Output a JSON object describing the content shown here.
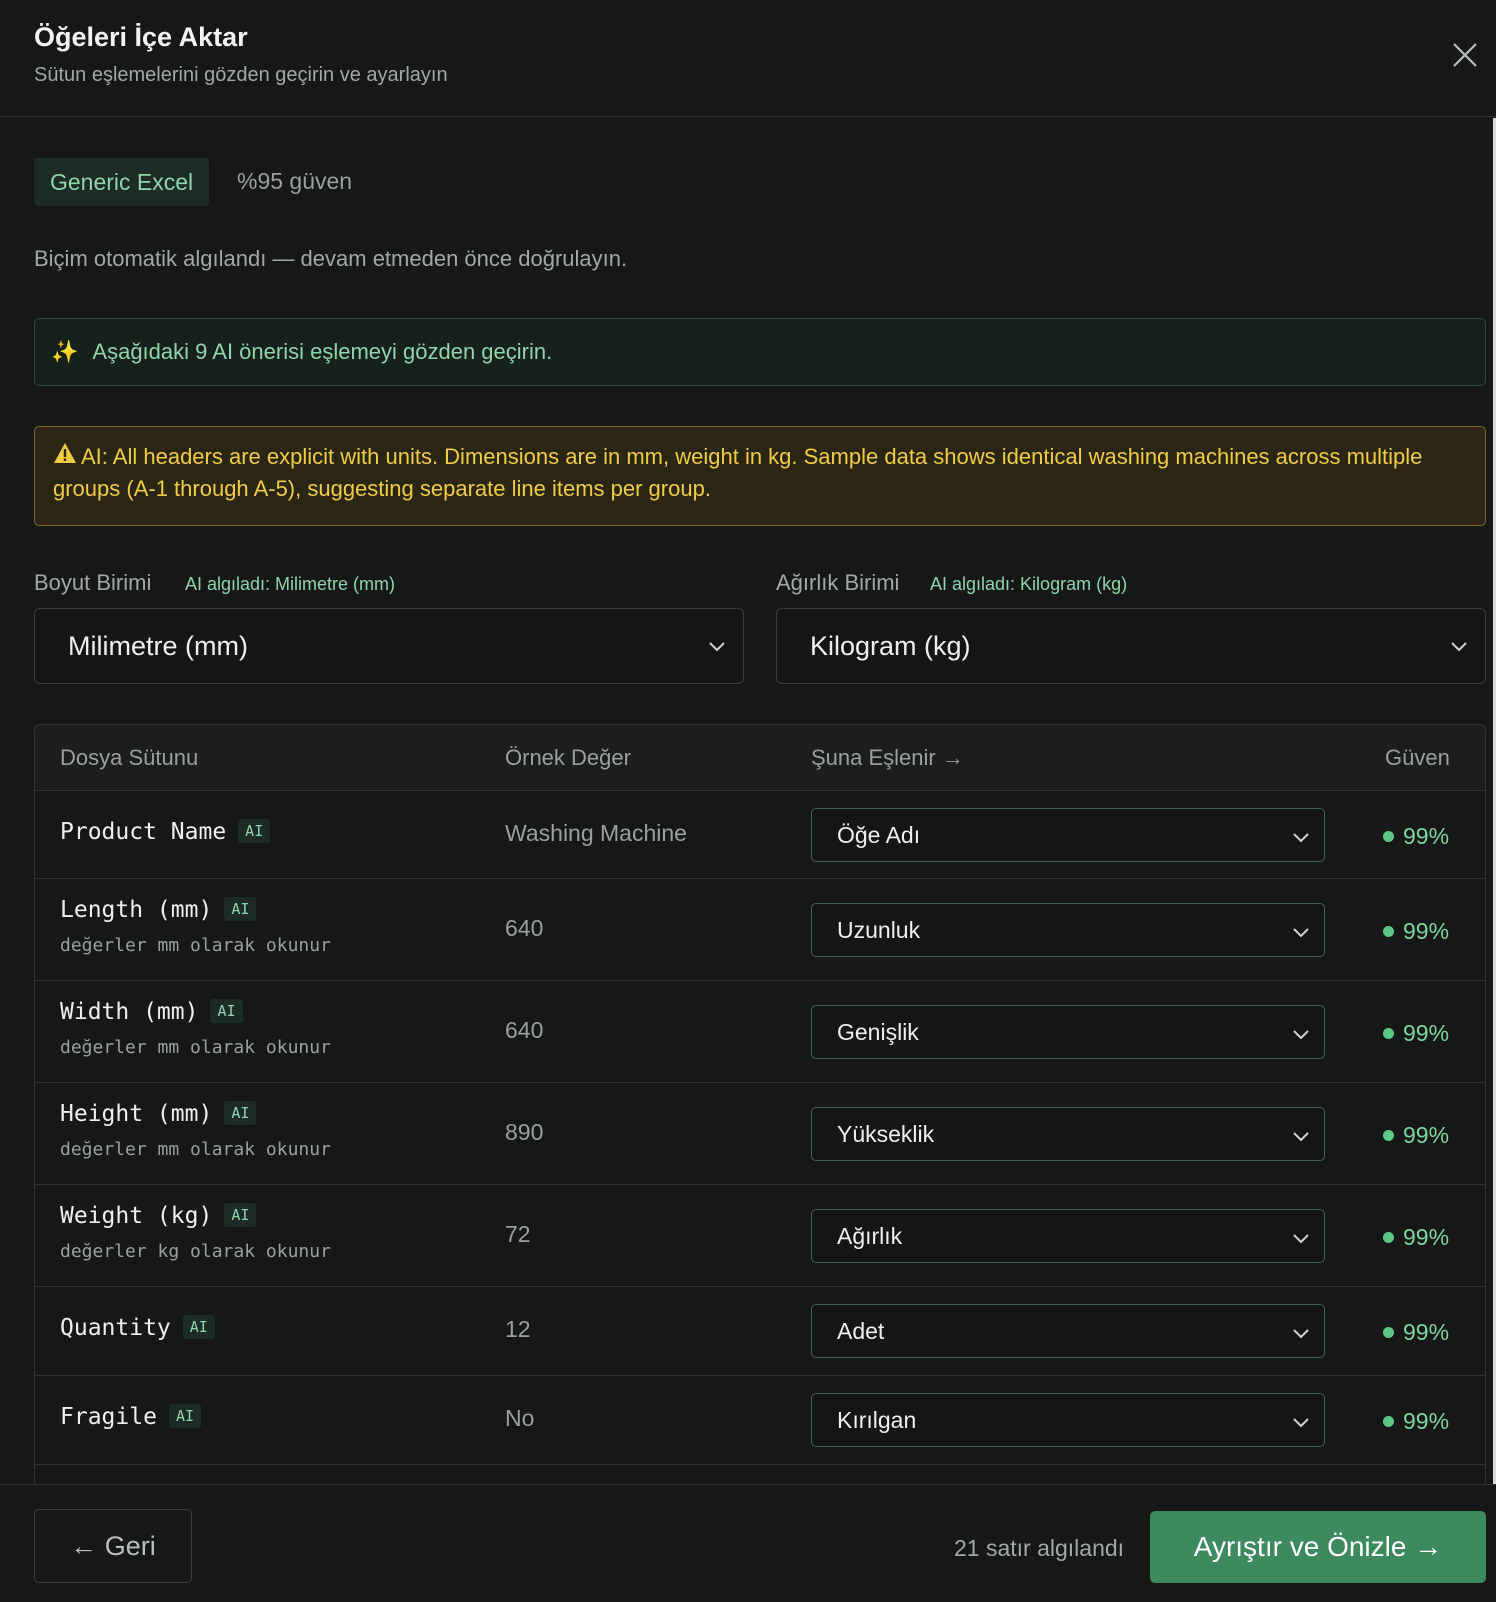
{
  "header": {
    "title": "Öğeleri İçe Aktar",
    "subtitle": "Sütun eşlemelerini gözden geçirin ve ayarlayın"
  },
  "format": {
    "badge": "Generic Excel",
    "confidence": "%95 güven",
    "note": "Biçim otomatik algılandı — devam etmeden önce doğrulayın."
  },
  "ai_banner": {
    "text": "Aşağıdaki 9 AI önerisi eşlemeyi gözden geçirin."
  },
  "warning": {
    "text": "AI: All headers are explicit with units. Dimensions are in mm, weight in kg. Sample data shows identical washing machines across multiple groups (A-1 through A-5), suggesting separate line items per group."
  },
  "units": {
    "dimension": {
      "label": "Boyut Birimi",
      "hint": "AI algıladı: Milimetre (mm)",
      "value": "Milimetre (mm)"
    },
    "weight": {
      "label": "Ağırlık Birimi",
      "hint": "AI algıladı: Kilogram (kg)",
      "value": "Kilogram (kg)"
    }
  },
  "table": {
    "headers": {
      "file_column": "Dosya Sütunu",
      "sample": "Örnek Değer",
      "maps_to": "Şuna Eşlenir →",
      "confidence": "Güven"
    },
    "ai_tag": "AI",
    "rows": [
      {
        "column": "Product Name",
        "note": "",
        "sample": "Washing Machine",
        "mapping": "Öğe Adı",
        "confidence": "99%"
      },
      {
        "column": "Length (mm)",
        "note": "değerler mm olarak okunur",
        "sample": "640",
        "mapping": "Uzunluk",
        "confidence": "99%"
      },
      {
        "column": "Width (mm)",
        "note": "değerler mm olarak okunur",
        "sample": "640",
        "mapping": "Genişlik",
        "confidence": "99%"
      },
      {
        "column": "Height (mm)",
        "note": "değerler mm olarak okunur",
        "sample": "890",
        "mapping": "Yükseklik",
        "confidence": "99%"
      },
      {
        "column": "Weight (kg)",
        "note": "değerler kg olarak okunur",
        "sample": "72",
        "mapping": "Ağırlık",
        "confidence": "99%"
      },
      {
        "column": "Quantity",
        "note": "",
        "sample": "12",
        "mapping": "Adet",
        "confidence": "99%"
      },
      {
        "column": "Fragile",
        "note": "",
        "sample": "No",
        "mapping": "Kırılgan",
        "confidence": "99%"
      }
    ]
  },
  "footer": {
    "back_label": "← Geri",
    "rows_detected": "21 satır algılandı",
    "primary_label": "Ayrıştır ve Önizle →"
  },
  "colors": {
    "background": "#161817",
    "accent_green": "#3d8a5f",
    "ai_text": "#8fd4ac",
    "warning_text": "#f0cc45",
    "confidence_dot": "#5cc886"
  }
}
